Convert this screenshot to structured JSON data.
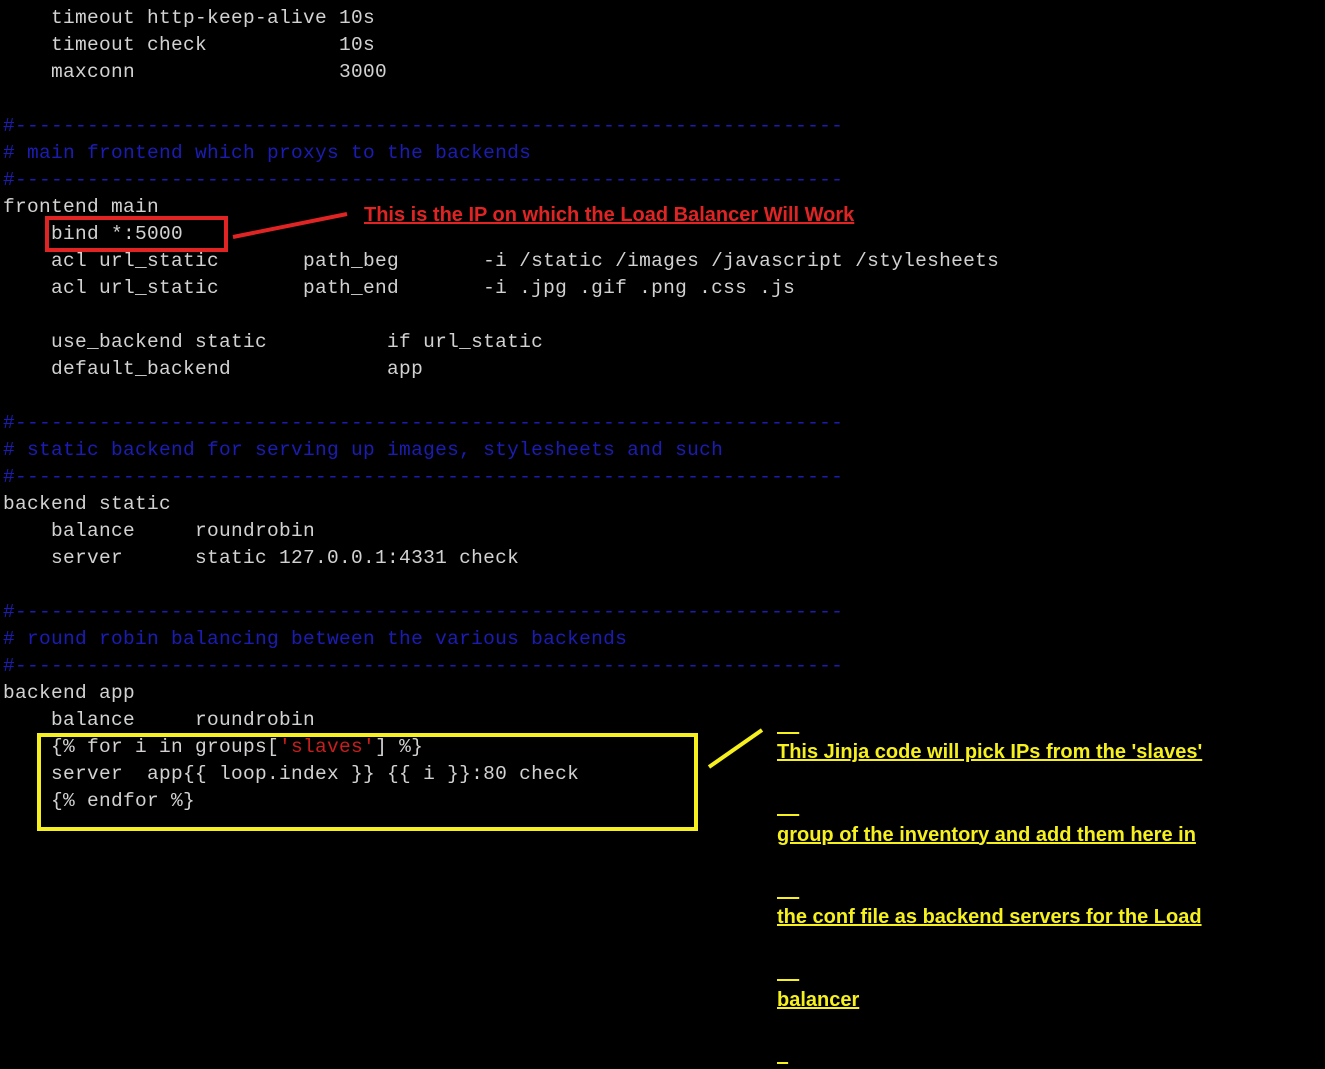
{
  "terminal": {
    "lines": [
      {
        "text": "    timeout http-keep-alive 10s",
        "kind": "code"
      },
      {
        "text": "    timeout check           10s",
        "kind": "code"
      },
      {
        "text": "    maxconn                 3000",
        "kind": "code"
      },
      {
        "text": "",
        "kind": "blank"
      },
      {
        "text": "#---------------------------------------------------------------------",
        "kind": "comment"
      },
      {
        "text": "# main frontend which proxys to the backends",
        "kind": "comment"
      },
      {
        "text": "#---------------------------------------------------------------------",
        "kind": "comment"
      },
      {
        "text": "frontend main",
        "kind": "code"
      },
      {
        "text": "    bind *:5000",
        "kind": "code"
      },
      {
        "text": "    acl url_static       path_beg       -i /static /images /javascript /stylesheets",
        "kind": "code"
      },
      {
        "text": "    acl url_static       path_end       -i .jpg .gif .png .css .js",
        "kind": "code"
      },
      {
        "text": "",
        "kind": "blank"
      },
      {
        "text": "    use_backend static          if url_static",
        "kind": "code"
      },
      {
        "text": "    default_backend             app",
        "kind": "code"
      },
      {
        "text": "",
        "kind": "blank"
      },
      {
        "text": "#---------------------------------------------------------------------",
        "kind": "comment"
      },
      {
        "text": "# static backend for serving up images, stylesheets and such",
        "kind": "comment"
      },
      {
        "text": "#---------------------------------------------------------------------",
        "kind": "comment"
      },
      {
        "text": "backend static",
        "kind": "code"
      },
      {
        "text": "    balance     roundrobin",
        "kind": "code"
      },
      {
        "text": "    server      static 127.0.0.1:4331 check",
        "kind": "code"
      },
      {
        "text": "",
        "kind": "blank"
      },
      {
        "text": "#---------------------------------------------------------------------",
        "kind": "comment"
      },
      {
        "text": "# round robin balancing between the various backends",
        "kind": "comment"
      },
      {
        "text": "#---------------------------------------------------------------------",
        "kind": "comment"
      },
      {
        "text": "backend app",
        "kind": "code"
      },
      {
        "text": "    balance     roundrobin",
        "kind": "code"
      },
      {
        "text": "    {% for i in groups['slaves'] %}",
        "kind": "code",
        "highlight": "'slaves'"
      },
      {
        "text": "    server  app{{ loop.index }} {{ i }}:80 check",
        "kind": "code"
      },
      {
        "text": "    {% endfor %}",
        "kind": "code"
      }
    ]
  },
  "annotations": {
    "red_note": "This is the IP on which the Load Balancer Will Work",
    "yellow_note": [
      "This Jinja code will pick IPs from the 'slaves'",
      "group of the inventory and add them here in",
      "the conf file as backend servers for the Load",
      "balancer"
    ]
  },
  "colors": {
    "background": "#000000",
    "text": "#d2d2d2",
    "comment": "#1c1cb4",
    "string": "#c81e1e",
    "red_annotation": "#e02424",
    "yellow_annotation": "#f5f01e"
  }
}
